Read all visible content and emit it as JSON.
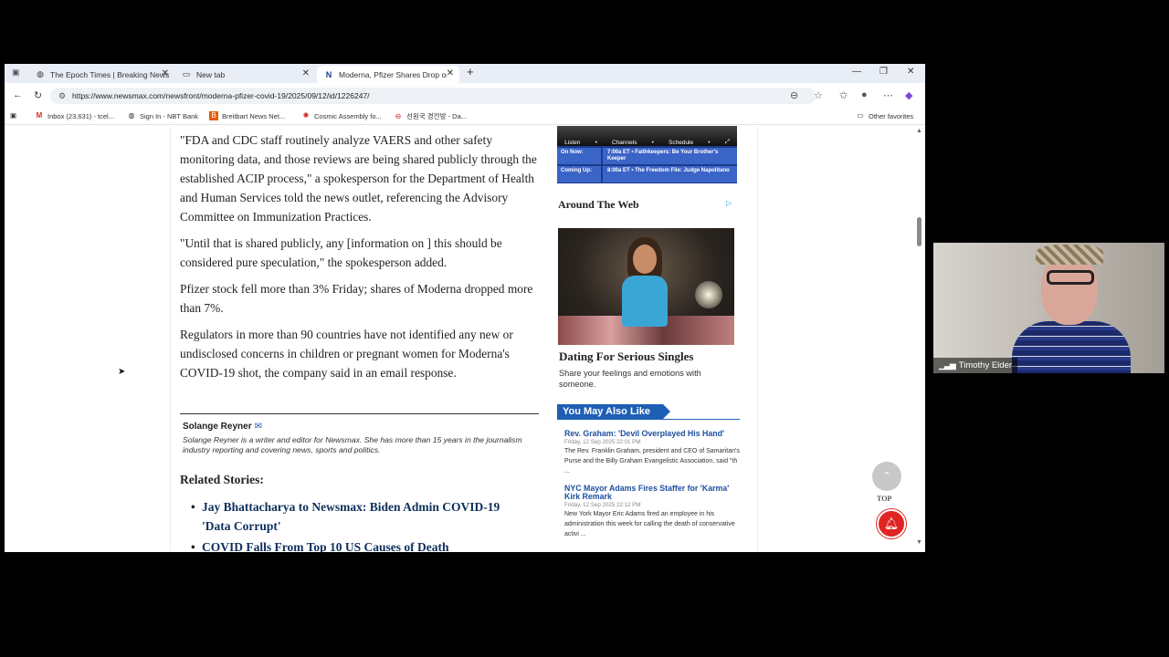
{
  "browser": {
    "tabs": [
      {
        "label": "The Epoch Times | Breaking News",
        "icon": "globe-icon"
      },
      {
        "label": "New tab",
        "icon": "newtab-icon"
      },
      {
        "label": "Moderna, Pfizer Shares Drop on R",
        "icon": "newsmax-icon",
        "active": true
      }
    ],
    "new_tab_label": "+",
    "url": "https://www.newsmax.com/newsfront/moderna-pfizer-covid-19/2025/09/12/id/1226247/",
    "bookmarks": [
      {
        "label": "Inbox (23,631) - tcel...",
        "icon": "gmail-icon"
      },
      {
        "label": "Sign In - NBT Bank",
        "icon": "globe-icon"
      },
      {
        "label": "Breitbart News Net...",
        "icon": "breitbart-icon"
      },
      {
        "label": "Cosmic Assembly fo...",
        "icon": "cosmic-icon"
      },
      {
        "label": "선원국 경전방 - Da...",
        "icon": "circle-icon"
      }
    ],
    "other_favorites": "Other favorites"
  },
  "article": {
    "paragraphs": [
      "\"FDA and CDC staff routinely analyze VAERS and other safety monitoring data, and those reviews are being shared publicly through the established ACIP process,\" a spokesperson for the Department of Health and Human Services told the news outlet, referencing the Advisory Committee on Immunization Practices.",
      "\"Until that is shared publicly, any [information on ] this should be considered pure speculation,\" the spokesperson added.",
      "Pfizer stock fell more than 3% Friday; shares of Moderna dropped more than 7%.",
      "Regulators in more than 90 countries have not identified any new or undisclosed concerns in children or pregnant women for Moderna's COVID-19 shot, the company said in an email response."
    ],
    "author": {
      "name": "Solange Reyner",
      "bio": "Solange Reyner is a writer and editor for Newsmax. She has more than 15 years in the journalism industry reporting and covering news, sports and politics."
    },
    "related_title": "Related Stories:",
    "related": [
      "Jay Bhattacharya to Newsmax: Biden Admin COVID-19 'Data Corrupt'",
      "COVID Falls From Top 10 US Causes of Death"
    ]
  },
  "sidebar": {
    "schedule": {
      "nav": [
        "Listen",
        "Channels",
        "Schedule"
      ],
      "on_now_label": "On Now:",
      "on_now_value": "7:00a ET  •  Faithkeepers: Be Your Brother's Keeper",
      "coming_up_label": "Coming Up:",
      "coming_up_value": "8:00a ET  •  The Freedom File: Judge Napolitano"
    },
    "around_web": "Around The Web",
    "ad": {
      "title": "Dating For Serious Singles",
      "desc": "Share your feelings and emotions with someone."
    },
    "you_may_also_like": "You May Also Like",
    "stories": [
      {
        "title": "Rev. Graham: 'Devil Overplayed His Hand'",
        "date": "Friday, 12 Sep 2025 22:01 PM",
        "text": "The Rev. Franklin Graham, president and CEO of Samaritan's Purse and the Billy Graham Evangelistic Association, said \"th ..."
      },
      {
        "title": "NYC Mayor Adams Fires Staffer for 'Karma' Kirk Remark",
        "date": "Friday, 12 Sep 2025 22:12 PM",
        "text": "New York Mayor Eric Adams fired an employee in his administration this week for calling the death of conservative activi ..."
      }
    ]
  },
  "controls": {
    "top_label": "TOP"
  },
  "video": {
    "participant_name": "Timothy Elder"
  },
  "colors": {
    "accent": "#1d5fb4",
    "notify": "#e02424",
    "link": "#0e2f5c"
  }
}
